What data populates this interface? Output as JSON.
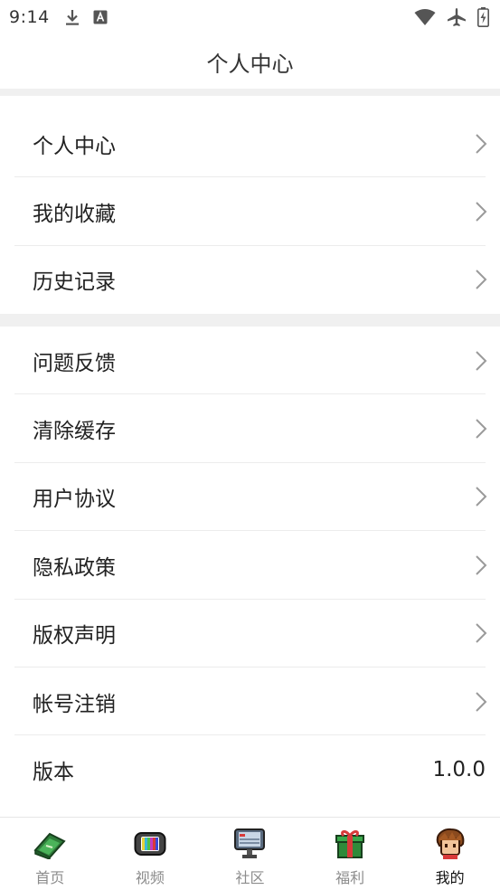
{
  "status_bar": {
    "time": "9:14",
    "icons_left": [
      "download-icon",
      "text-a-icon"
    ],
    "icons_right": [
      "wifi-icon",
      "airplane-icon",
      "battery-charging-icon"
    ]
  },
  "header": {
    "title": "个人中心"
  },
  "menu_group_1": [
    {
      "label": "个人中心"
    },
    {
      "label": "我的收藏"
    },
    {
      "label": "历史记录"
    }
  ],
  "menu_group_2": [
    {
      "label": "问题反馈"
    },
    {
      "label": "清除缓存"
    },
    {
      "label": "用户协议"
    },
    {
      "label": "隐私政策"
    },
    {
      "label": "版权声明"
    },
    {
      "label": "帐号注销"
    },
    {
      "label": "版本",
      "value": "1.0.0"
    }
  ],
  "tabs": [
    {
      "label": "首页",
      "icon": "book-icon",
      "active": false
    },
    {
      "label": "视频",
      "icon": "tv-icon",
      "active": false
    },
    {
      "label": "社区",
      "icon": "monitor-icon",
      "active": false
    },
    {
      "label": "福利",
      "icon": "gift-icon",
      "active": false
    },
    {
      "label": "我的",
      "icon": "avatar-icon",
      "active": true
    }
  ],
  "colors": {
    "background": "#ffffff",
    "section_gap": "#f0f0f0",
    "divider": "#ececec",
    "text": "#222222",
    "tab_inactive": "#8c8c8c",
    "tab_active": "#111111"
  }
}
